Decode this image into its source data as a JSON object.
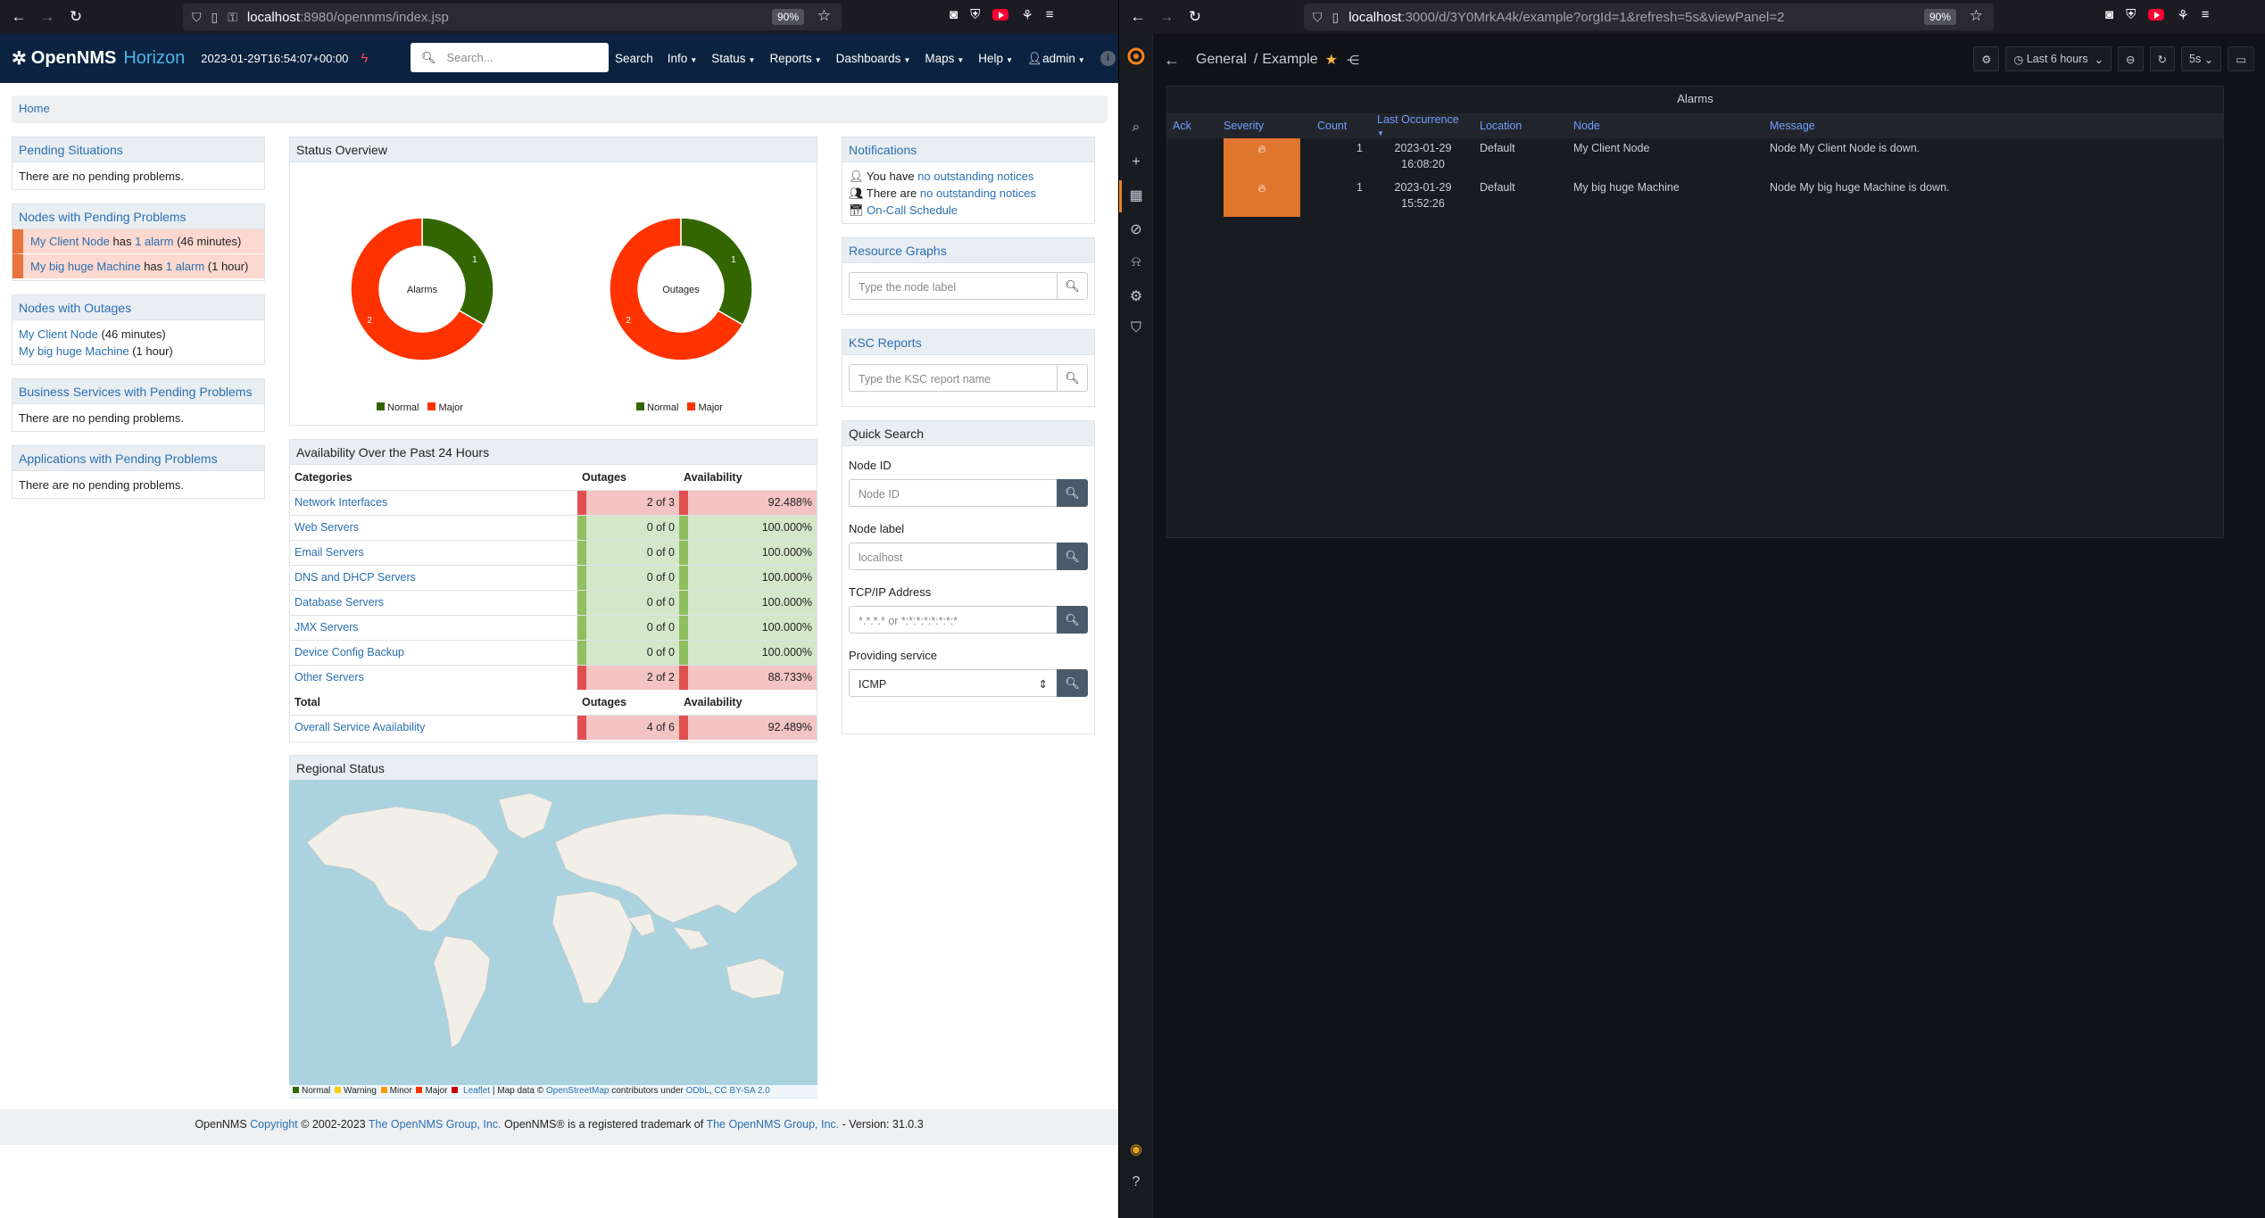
{
  "left_browser": {
    "url_host": "localhost",
    "url_path": ":8980/opennms/index.jsp",
    "zoom": "90%"
  },
  "right_browser": {
    "url_host": "localhost",
    "url_path": ":3000/d/3Y0MrkA4k/example?orgId=1&refresh=5s&viewPanel=2",
    "zoom": "90%"
  },
  "opennms": {
    "brand": "OpenNMS",
    "brand_sub": "Horizon",
    "timestamp": "2023-01-29T16:54:07+00:00",
    "search_placeholder": "Search...",
    "menu": [
      "Search",
      "Info",
      "Status",
      "Reports",
      "Dashboards",
      "Maps",
      "Help",
      "admin"
    ],
    "breadcrumb": "Home",
    "pending_situations": {
      "title": "Pending Situations",
      "text": "There are no pending problems."
    },
    "nodes_pending": {
      "title": "Nodes with Pending Problems",
      "rows": [
        {
          "node": "My Client Node",
          "has": "has",
          "alarm": "1 alarm",
          "age": "(46 minutes)"
        },
        {
          "node": "My big huge Machine",
          "has": "has",
          "alarm": "1 alarm",
          "age": "(1 hour)"
        }
      ]
    },
    "nodes_outages": {
      "title": "Nodes with Outages",
      "rows": [
        {
          "node": "My Client Node",
          "age": "(46 minutes)"
        },
        {
          "node": "My big huge Machine",
          "age": "(1 hour)"
        }
      ]
    },
    "business_services": {
      "title": "Business Services with Pending Problems",
      "text": "There are no pending problems."
    },
    "applications": {
      "title": "Applications with Pending Problems",
      "text": "There are no pending problems."
    },
    "status_overview": {
      "title": "Status Overview",
      "donuts": [
        {
          "label": "Alarms",
          "normal": 1,
          "major": 2
        },
        {
          "label": "Outages",
          "normal": 1,
          "major": 2
        }
      ],
      "legend_normal": "Normal",
      "legend_major": "Major"
    },
    "availability": {
      "title": "Availability Over the Past 24 Hours",
      "col_categories": "Categories",
      "col_outages": "Outages",
      "col_availability": "Availability",
      "rows": [
        {
          "name": "Network Interfaces",
          "outages": "2 of 3",
          "avail": "92.488%",
          "status": "bad"
        },
        {
          "name": "Web Servers",
          "outages": "0 of 0",
          "avail": "100.000%",
          "status": "good"
        },
        {
          "name": "Email Servers",
          "outages": "0 of 0",
          "avail": "100.000%",
          "status": "good"
        },
        {
          "name": "DNS and DHCP Servers",
          "outages": "0 of 0",
          "avail": "100.000%",
          "status": "good"
        },
        {
          "name": "Database Servers",
          "outages": "0 of 0",
          "avail": "100.000%",
          "status": "good"
        },
        {
          "name": "JMX Servers",
          "outages": "0 of 0",
          "avail": "100.000%",
          "status": "good"
        },
        {
          "name": "Device Config Backup",
          "outages": "0 of 0",
          "avail": "100.000%",
          "status": "good"
        },
        {
          "name": "Other Servers",
          "outages": "2 of 2",
          "avail": "88.733%",
          "status": "bad"
        }
      ],
      "total_label": "Total",
      "total_row": {
        "name": "Overall Service Availability",
        "outages": "4 of 6",
        "avail": "92.489%",
        "status": "bad"
      }
    },
    "regional_status": {
      "title": "Regional Status",
      "attribution": {
        "legend": [
          "Normal",
          "Warning",
          "Minor",
          "Major"
        ],
        "leaflet": "Leaflet",
        "map_data": "| Map data ©",
        "osm": "OpenStreetMap",
        "contrib": "contributors under",
        "odbl": "ODbL",
        "ccbysa": "CC BY-SA 2.0"
      }
    },
    "notifications": {
      "title": "Notifications",
      "line1_pre": "You have",
      "line1_link": "no outstanding notices",
      "line2_pre": "There are",
      "line2_link": "no outstanding notices",
      "line3": "On-Call Schedule"
    },
    "resource_graphs": {
      "title": "Resource Graphs",
      "placeholder": "Type the node label"
    },
    "ksc_reports": {
      "title": "KSC Reports",
      "placeholder": "Type the KSC report name"
    },
    "quick_search": {
      "title": "Quick Search",
      "node_id_label": "Node ID",
      "node_id_placeholder": "Node ID",
      "node_label_label": "Node label",
      "node_label_placeholder": "localhost",
      "ip_label": "TCP/IP Address",
      "ip_placeholder": "*.*.*.* or *:*:*:*:*:*:*:*",
      "service_label": "Providing service",
      "service_value": "ICMP"
    },
    "footer": {
      "p1": "OpenNMS",
      "copyright": "Copyright",
      "p2": "© 2002-2023",
      "group1": "The OpenNMS Group, Inc.",
      "p3": "OpenNMS® is a registered trademark of",
      "group2": "The OpenNMS Group, Inc.",
      "version": "- Version: 31.0.3"
    }
  },
  "grafana": {
    "breadcrumb_folder": "General",
    "breadcrumb_sep": "/",
    "dashboard": "Example",
    "time_range": "Last 6 hours",
    "refresh": "5s",
    "panel_title": "Alarms",
    "columns": [
      "Ack",
      "Severity",
      "Count",
      "Last Occurrence",
      "Location",
      "Node",
      "Message"
    ],
    "rows": [
      {
        "count": "1",
        "date": "2023-01-29",
        "time": "16:08:20",
        "location": "Default",
        "node": "My Client Node",
        "message": "Node My Client Node is down.",
        "severity_color": "#e0752d"
      },
      {
        "count": "1",
        "date": "2023-01-29",
        "time": "15:52:26",
        "location": "Default",
        "node": "My big huge Machine",
        "message": "Node My big huge Machine is down.",
        "severity_color": "#e0752d"
      }
    ]
  },
  "colors": {
    "normal": "#336600",
    "major": "#ff3300",
    "bad_bar": "#e05050",
    "good_bar": "#8fbf60",
    "navy": "#0b2340",
    "grafana_bg": "#111217"
  }
}
